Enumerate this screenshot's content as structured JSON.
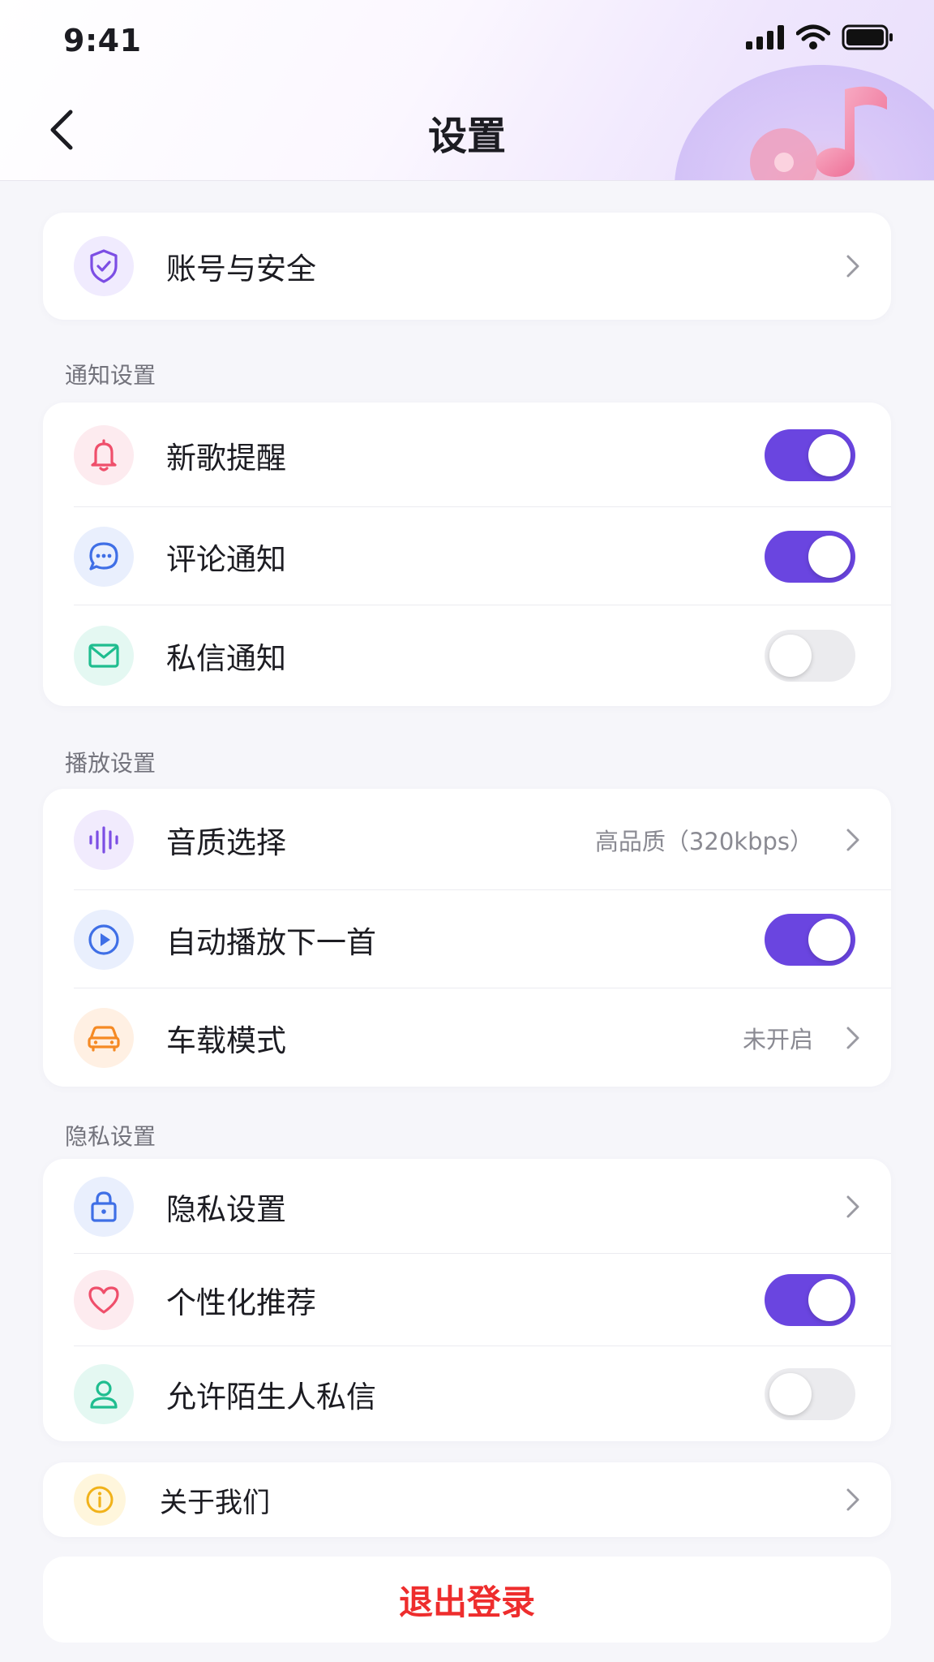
{
  "status_bar": {
    "time": "9:41"
  },
  "header": {
    "title": "设置"
  },
  "account": {
    "label": "账号与安全"
  },
  "notification_section": {
    "title": "通知设置",
    "items": [
      {
        "label": "新歌提醒",
        "toggle": "on"
      },
      {
        "label": "评论通知",
        "toggle": "on"
      },
      {
        "label": "私信通知",
        "toggle": "off"
      }
    ]
  },
  "playback_section": {
    "title": "播放设置",
    "items": [
      {
        "label": "音质选择",
        "value": "高品质（320kbps）"
      },
      {
        "label": "自动播放下一首",
        "toggle": "on"
      },
      {
        "label": "车载模式",
        "value": "未开启"
      }
    ]
  },
  "privacy_section": {
    "title": "隐私设置",
    "items": [
      {
        "label": "隐私设置"
      },
      {
        "label": "个性化推荐",
        "toggle": "on"
      },
      {
        "label": "允许陌生人私信",
        "toggle": "off"
      }
    ]
  },
  "about": {
    "label": "关于我们"
  },
  "logout": {
    "label": "退出登录"
  },
  "colors": {
    "accent": "#6a45e0",
    "logout": "#ee2d2d"
  },
  "icons": [
    "shield-icon",
    "bell-icon",
    "comment-icon",
    "mail-icon",
    "sound-wave-icon",
    "play-icon",
    "car-icon",
    "lock-icon",
    "heart-icon",
    "user-icon",
    "info-icon",
    "chevron-right-icon",
    "back-icon"
  ]
}
